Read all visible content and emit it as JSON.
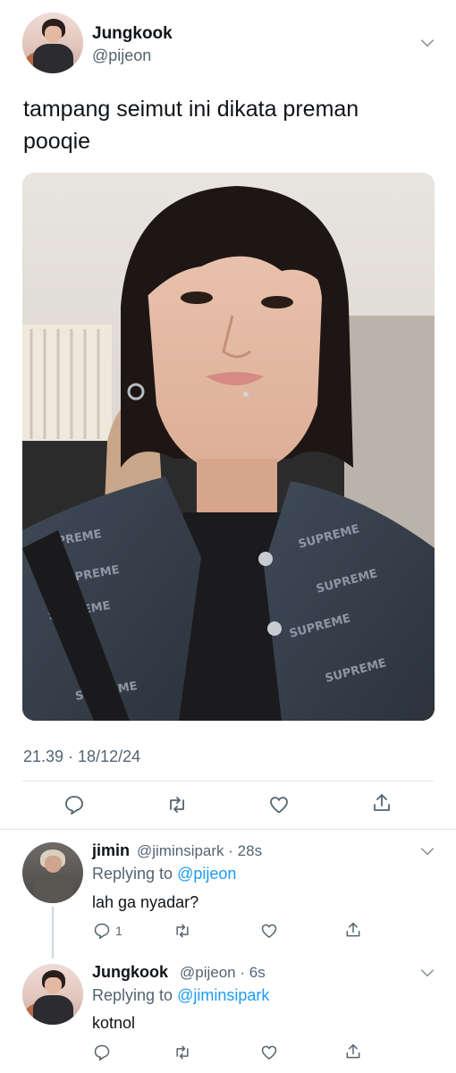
{
  "tweet": {
    "author_name": "Jungkook",
    "author_handle": "@pijeon",
    "text_line1": "tampang seimut ini dikata preman",
    "text_line2": "pooqie",
    "photo_icon": "selfie-photo",
    "timestamp": "21.39 · 18/12/24",
    "actions": {
      "reply_icon": "reply-icon",
      "retweet_icon": "retweet-icon",
      "like_icon": "like-icon",
      "share_icon": "share-icon"
    }
  },
  "replies": [
    {
      "author_name": "jimin",
      "handle_time": "@jiminsipark · 28s",
      "replying_prefix": "Replying to ",
      "replying_to": "@pijeon",
      "text": "lah ga nyadar?",
      "reply_count": "1"
    },
    {
      "author_name": "Jungkook",
      "handle_time": "@pijeon · 6s",
      "replying_prefix": "Replying to ",
      "replying_to": "@jiminsipark",
      "text": "kotnol",
      "reply_count": ""
    }
  ],
  "colors": {
    "text": "#0f1419",
    "secondary": "#536471",
    "link": "#1d9bf0",
    "divider": "#e1e6ea"
  }
}
